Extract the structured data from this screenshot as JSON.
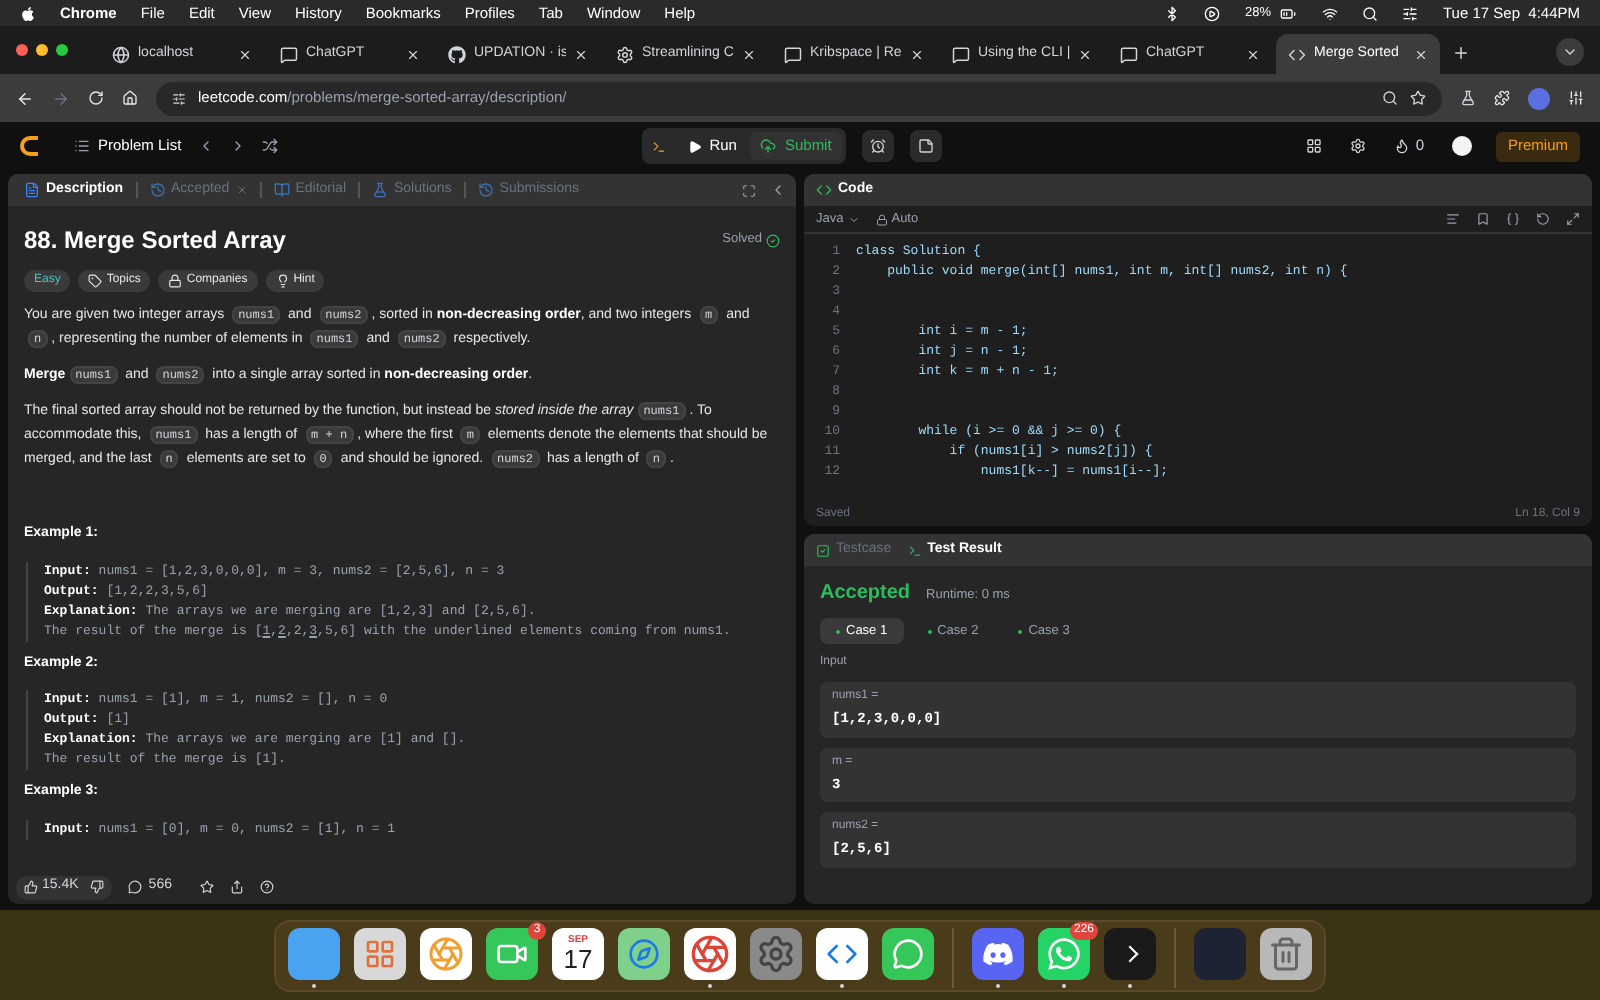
{
  "menubar": {
    "app": "Chrome",
    "menus": [
      "File",
      "Edit",
      "View",
      "History",
      "Bookmarks",
      "Profiles",
      "Tab",
      "Window",
      "Help"
    ],
    "battery": "28%",
    "datetime": "Tue 17 Sep  4:44PM"
  },
  "browser_tabs": [
    {
      "title": "localhost",
      "kind": "globe",
      "selected": false
    },
    {
      "title": "ChatGPT",
      "kind": "chat",
      "selected": false
    },
    {
      "title": "UPDATION · is",
      "kind": "github",
      "selected": false
    },
    {
      "title": "Streamlining C",
      "kind": "gear",
      "selected": false
    },
    {
      "title": "Kribspace | Re",
      "kind": "chat",
      "selected": false
    },
    {
      "title": "Using the CLI |",
      "kind": "chat",
      "selected": false
    },
    {
      "title": "ChatGPT",
      "kind": "chat",
      "selected": false
    },
    {
      "title": "Merge Sorted",
      "kind": "leetcode",
      "selected": true
    }
  ],
  "address": {
    "host": "leetcode.com",
    "path": "/problems/merge-sorted-array/description/"
  },
  "lc_nav": {
    "problem_list": "Problem List",
    "run": "Run",
    "submit": "Submit",
    "streak": "0",
    "premium": "Premium"
  },
  "left_tabs": [
    {
      "label": "Description",
      "kind": "description",
      "selected": true,
      "closable": false
    },
    {
      "label": "Accepted",
      "kind": "history",
      "selected": false,
      "closable": true
    },
    {
      "label": "Editorial",
      "kind": "book",
      "selected": false,
      "closable": false
    },
    {
      "label": "Solutions",
      "kind": "flask",
      "selected": false,
      "closable": false
    },
    {
      "label": "Submissions",
      "kind": "history",
      "selected": false,
      "closable": false
    }
  ],
  "problem": {
    "title": "88. Merge Sorted Array",
    "status": "Solved",
    "tags": [
      {
        "label": "Easy",
        "kind": "difficulty"
      },
      {
        "label": "Topics",
        "kind": "topics"
      },
      {
        "label": "Companies",
        "kind": "companies"
      },
      {
        "label": "Hint",
        "kind": "hint"
      }
    ],
    "paragraphs": [
      [
        {
          "kind": "text",
          "text": "You are given two integer arrays "
        },
        {
          "kind": "code",
          "text": "nums1"
        },
        {
          "kind": "text",
          "text": " and "
        },
        {
          "kind": "code",
          "text": "nums2"
        },
        {
          "kind": "text",
          "text": ", sorted in "
        },
        {
          "kind": "bold",
          "text": "non-decreasing order"
        },
        {
          "kind": "text",
          "text": ", and two integers "
        },
        {
          "kind": "code",
          "text": "m"
        },
        {
          "kind": "text",
          "text": " and "
        },
        {
          "kind": "code",
          "text": "n"
        },
        {
          "kind": "text",
          "text": ", representing the number of elements in "
        },
        {
          "kind": "code",
          "text": "nums1"
        },
        {
          "kind": "text",
          "text": " and "
        },
        {
          "kind": "code",
          "text": "nums2"
        },
        {
          "kind": "text",
          "text": " respectively."
        }
      ],
      [
        {
          "kind": "bold",
          "text": "Merge"
        },
        {
          "kind": "code",
          "text": "nums1"
        },
        {
          "kind": "text",
          "text": " and "
        },
        {
          "kind": "code",
          "text": "nums2"
        },
        {
          "kind": "text",
          "text": " into a single array sorted in "
        },
        {
          "kind": "bold",
          "text": "non-decreasing order"
        },
        {
          "kind": "text",
          "text": "."
        }
      ],
      [
        {
          "kind": "text",
          "text": "The final sorted array should not be returned by the function, but instead be "
        },
        {
          "kind": "italic",
          "text": "stored inside the array"
        },
        {
          "kind": "code",
          "text": "nums1"
        },
        {
          "kind": "text",
          "text": ". To accommodate this, "
        },
        {
          "kind": "code",
          "text": "nums1"
        },
        {
          "kind": "text",
          "text": " has a length of "
        },
        {
          "kind": "code",
          "text": "m + n"
        },
        {
          "kind": "text",
          "text": ", where the first "
        },
        {
          "kind": "code",
          "text": "m"
        },
        {
          "kind": "text",
          "text": " elements denote the elements that should be merged, and the last "
        },
        {
          "kind": "code",
          "text": "n"
        },
        {
          "kind": "text",
          "text": " elements are set to "
        },
        {
          "kind": "code",
          "text": "0"
        },
        {
          "kind": "text",
          "text": " and should be ignored. "
        },
        {
          "kind": "code",
          "text": "nums2"
        },
        {
          "kind": "text",
          "text": " has a length of "
        },
        {
          "kind": "code",
          "text": "n"
        },
        {
          "kind": "text",
          "text": "."
        }
      ]
    ],
    "examples": [
      {
        "title": "Example 1:",
        "lines": [
          {
            "label": "Input:",
            "parts": [
              {
                "text": " nums1 = [1,2,3,0,0,0], m = 3, nums2 = [2,5,6], n = 3",
                "underlined": false
              }
            ]
          },
          {
            "label": "Output:",
            "parts": [
              {
                "text": " [1,2,2,3,5,6]",
                "underlined": false
              }
            ]
          },
          {
            "label": "Explanation:",
            "parts": [
              {
                "text": " The arrays we are merging are [1,2,3] and [2,5,6].",
                "underlined": false
              }
            ]
          },
          {
            "parts": [
              {
                "text": "The result of the merge is [",
                "underlined": false
              },
              {
                "text": "1",
                "underlined": true
              },
              {
                "text": ",",
                "underlined": false
              },
              {
                "text": "2",
                "underlined": true
              },
              {
                "text": ",2,",
                "underlined": false
              },
              {
                "text": "3",
                "underlined": true
              },
              {
                "text": ",5,6] with the underlined elements coming from nums1.",
                "underlined": false
              }
            ]
          }
        ]
      },
      {
        "title": "Example 2:",
        "lines": [
          {
            "label": "Input:",
            "parts": [
              {
                "text": " nums1 = [1], m = 1, nums2 = [], n = 0",
                "underlined": false
              }
            ]
          },
          {
            "label": "Output:",
            "parts": [
              {
                "text": " [1]",
                "underlined": false
              }
            ]
          },
          {
            "label": "Explanation:",
            "parts": [
              {
                "text": " The arrays we are merging are [1] and [].",
                "underlined": false
              }
            ]
          },
          {
            "parts": [
              {
                "text": "The result of the merge is [1].",
                "underlined": false
              }
            ]
          }
        ]
      },
      {
        "title": "Example 3:",
        "lines": [
          {
            "label": "Input:",
            "parts": [
              {
                "text": " nums1 = [0], m = 0, nums2 = [1], n = 1",
                "underlined": false
              }
            ]
          }
        ]
      }
    ],
    "likes": "15.4K",
    "comments": "566"
  },
  "code_panel": {
    "title": "Code",
    "language": "Java",
    "mode": "Auto",
    "lines": [
      {
        "n": "1",
        "code": "class Solution {"
      },
      {
        "n": "2",
        "code": "    public void merge(int[] nums1, int m, int[] nums2, int n) {"
      },
      {
        "n": "3"
      },
      {
        "n": "4"
      },
      {
        "n": "5",
        "code": "        int i = m - 1;"
      },
      {
        "n": "6",
        "code": "        int j = n - 1;"
      },
      {
        "n": "7",
        "code": "        int k = m + n - 1;"
      },
      {
        "n": "8"
      },
      {
        "n": "9"
      },
      {
        "n": "10",
        "code": "        while (i >= 0 && j >= 0) {"
      },
      {
        "n": "11",
        "code": "            if (nums1[i] > nums2[j]) {"
      },
      {
        "n": "12",
        "code": "                nums1[k--] = nums1[i--];"
      }
    ],
    "status": "Saved",
    "position": "Ln 18, Col 9"
  },
  "result_panel": {
    "tabs": [
      {
        "label": "Testcase",
        "kind": "testcase",
        "selected": false
      },
      {
        "label": "Test Result",
        "kind": "terminal",
        "selected": true
      }
    ],
    "verdict": "Accepted",
    "runtime": "Runtime: 0 ms",
    "cases": [
      {
        "label": "Case 1",
        "selected": true
      },
      {
        "label": "Case 2",
        "selected": false
      },
      {
        "label": "Case 3",
        "selected": false
      }
    ],
    "input_label": "Input",
    "fields": [
      {
        "name": "nums1 =",
        "value": "[1,2,3,0,0,0]"
      },
      {
        "name": "m =",
        "value": "3"
      },
      {
        "name": "nums2 =",
        "value": "[2,5,6]"
      }
    ]
  },
  "dock": [
    {
      "kind": "finder",
      "running": true
    },
    {
      "kind": "launchpad",
      "running": false
    },
    {
      "kind": "photos",
      "running": false
    },
    {
      "kind": "facetime",
      "running": false,
      "badge": "3"
    },
    {
      "kind": "calendar",
      "running": false,
      "month": "SEP",
      "day": "17"
    },
    {
      "kind": "maps",
      "running": false
    },
    {
      "kind": "chrome",
      "running": true
    },
    {
      "kind": "settings",
      "running": false
    },
    {
      "kind": "vscode",
      "running": true
    },
    {
      "kind": "messages",
      "running": false
    },
    {
      "kind": "separator"
    },
    {
      "kind": "discord",
      "running": true
    },
    {
      "kind": "whatsapp",
      "running": true,
      "badge": "226"
    },
    {
      "kind": "terminal",
      "running": true
    },
    {
      "kind": "separator"
    },
    {
      "kind": "window",
      "running": false
    },
    {
      "kind": "trash",
      "running": false
    }
  ]
}
